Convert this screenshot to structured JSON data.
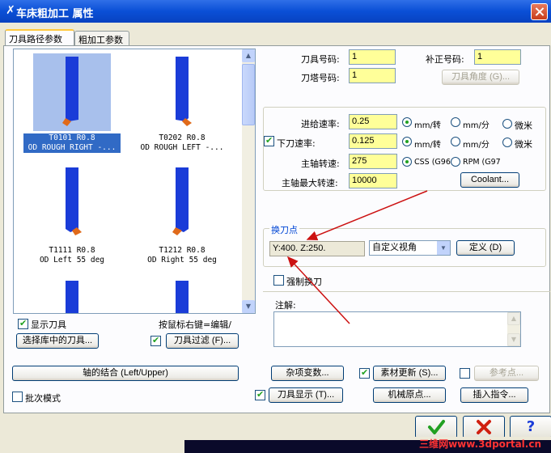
{
  "window": {
    "title": "车床粗加工 属性"
  },
  "tabs": [
    {
      "label": "刀具路径参数",
      "active": true
    },
    {
      "label": "粗加工参数",
      "active": false
    }
  ],
  "tool_list": [
    {
      "name": "T0101 R0.8",
      "desc": "OD ROUGH RIGHT -...",
      "selected": true
    },
    {
      "name": "T0202 R0.8",
      "desc": "OD ROUGH LEFT -...",
      "selected": false
    },
    {
      "name": "T1111 R0.8",
      "desc": "OD Left 55 deg",
      "selected": false
    },
    {
      "name": "T1212 R0.8",
      "desc": "OD Right 55 deg",
      "selected": false
    }
  ],
  "left_controls": {
    "show_tool_label": "显示刀具",
    "right_click_hint": "按鼠标右键=编辑/",
    "select_lib_button": "选择库中的刀具...",
    "tool_filter_button": "刀具过滤 (F)..."
  },
  "tool_params": {
    "tool_number_label": "刀具号码:",
    "tool_number_value": "1",
    "offset_number_label": "补正号码:",
    "offset_number_value": "1",
    "turret_number_label": "刀塔号码:",
    "turret_number_value": "1",
    "tool_angle_button": "刀具角度 (G)..."
  },
  "feed": {
    "feed_rate_label": "进给速率:",
    "feed_rate_value": "0.25",
    "plunge_rate_label": "下刀速率:",
    "plunge_rate_value": "0.125",
    "spindle_speed_label": "主轴转速:",
    "spindle_speed_value": "275",
    "max_spindle_label": "主轴最大转速:",
    "max_spindle_value": "10000",
    "unit_mm_rev": "mm/转",
    "unit_mm_min": "mm/分",
    "unit_micro": "微米",
    "css_label": "CSS (G96",
    "rpm_label": "RPM (G97",
    "coolant_button": "Coolant..."
  },
  "tool_change": {
    "group_label": "换刀点",
    "coords_text": "Y:400.   Z:250.",
    "view_select": "自定义视角",
    "define_button": "定义 (D)"
  },
  "force_tool_change_label": "强制换刀",
  "comment_label": "注解:",
  "bottom": {
    "axis_combo_button": "轴的结合 (Left/Upper)",
    "misc_vars_button": "杂项变数...",
    "stock_update_button": "素材更新 (S)...",
    "ref_point_button": "参考点...",
    "batch_mode_label": "批次模式",
    "tool_display_button": "刀具显示 (T)...",
    "machine_origin_button": "机械原点...",
    "insert_cmd_button": "插入指令..."
  },
  "dialog_buttons": {
    "ok_icon": "check-icon",
    "cancel_icon": "x-icon",
    "help_icon": "question-icon"
  },
  "watermark": "三维网www.3dportal.cn",
  "colors": {
    "title_bar": "#0a4fd6",
    "field_yellow": "#ffff99",
    "tool_blue": "#1a3cd8",
    "tool_orange": "#e06a1a",
    "selection": "#316ac5",
    "annotation_red": "#cc1111"
  }
}
